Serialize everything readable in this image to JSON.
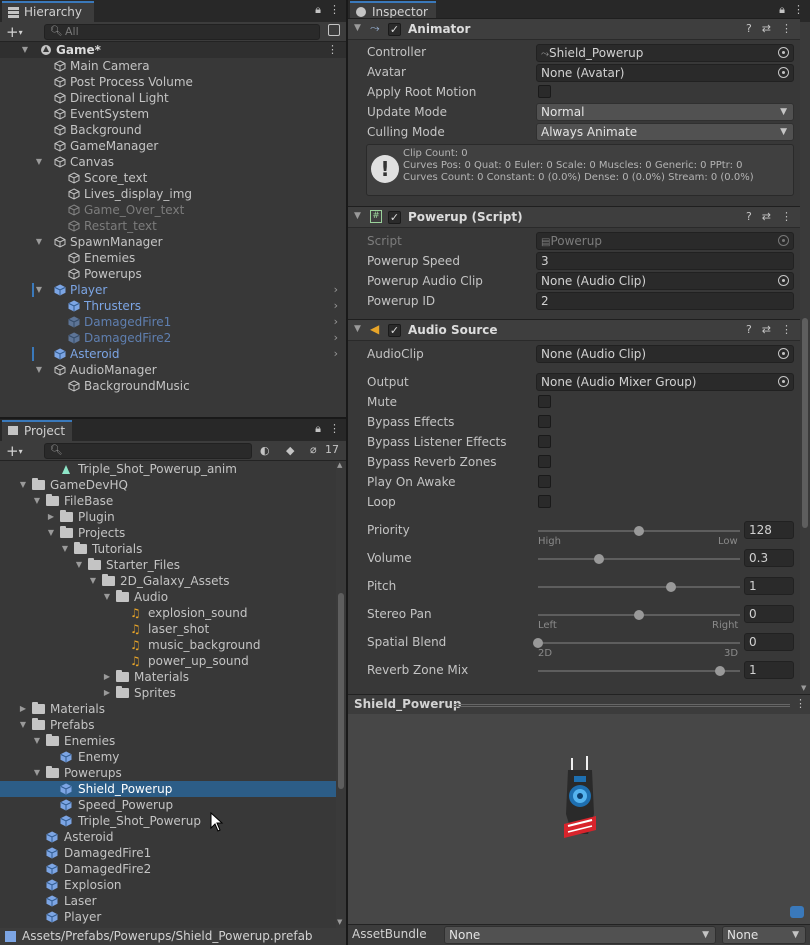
{
  "hierarchy": {
    "tab_label": "Hierarchy",
    "search_placeholder": "All",
    "rows": [
      {
        "label": "Game*",
        "depth": 0,
        "arrow": "down",
        "icon": "unity-scene-icon",
        "style": "bold"
      },
      {
        "label": "Main Camera",
        "depth": 1,
        "arrow": "",
        "icon": "gameobject-icon",
        "style": "normal"
      },
      {
        "label": "Post Process Volume",
        "depth": 1,
        "arrow": "",
        "icon": "gameobject-icon",
        "style": "normal"
      },
      {
        "label": "Directional Light",
        "depth": 1,
        "arrow": "",
        "icon": "gameobject-icon",
        "style": "normal"
      },
      {
        "label": "EventSystem",
        "depth": 1,
        "arrow": "",
        "icon": "gameobject-icon",
        "style": "normal"
      },
      {
        "label": "Background",
        "depth": 1,
        "arrow": "",
        "icon": "gameobject-icon",
        "style": "normal"
      },
      {
        "label": "GameManager",
        "depth": 1,
        "arrow": "",
        "icon": "gameobject-icon",
        "style": "normal"
      },
      {
        "label": "Canvas",
        "depth": 1,
        "arrow": "down",
        "icon": "gameobject-icon",
        "style": "normal"
      },
      {
        "label": "Score_text",
        "depth": 2,
        "arrow": "",
        "icon": "gameobject-icon",
        "style": "normal"
      },
      {
        "label": "Lives_display_img",
        "depth": 2,
        "arrow": "",
        "icon": "gameobject-icon",
        "style": "normal"
      },
      {
        "label": "Game_Over_text",
        "depth": 2,
        "arrow": "",
        "icon": "gameobject-icon",
        "style": "dim"
      },
      {
        "label": "Restart_text",
        "depth": 2,
        "arrow": "",
        "icon": "gameobject-icon",
        "style": "dim"
      },
      {
        "label": "SpawnManager",
        "depth": 1,
        "arrow": "down",
        "icon": "gameobject-icon",
        "style": "normal"
      },
      {
        "label": "Enemies",
        "depth": 2,
        "arrow": "",
        "icon": "gameobject-icon",
        "style": "normal"
      },
      {
        "label": "Powerups",
        "depth": 2,
        "arrow": "",
        "icon": "gameobject-icon",
        "style": "normal"
      },
      {
        "label": "Player",
        "depth": 1,
        "arrow": "down",
        "icon": "prefab-icon",
        "style": "blue",
        "chevron": true,
        "marker": true
      },
      {
        "label": "Thrusters",
        "depth": 2,
        "arrow": "",
        "icon": "prefab-icon",
        "style": "blue",
        "chevron": true
      },
      {
        "label": "DamagedFire1",
        "depth": 2,
        "arrow": "",
        "icon": "prefab-icon",
        "style": "dimblue",
        "chevron": true
      },
      {
        "label": "DamagedFire2",
        "depth": 2,
        "arrow": "",
        "icon": "prefab-icon",
        "style": "dimblue",
        "chevron": true
      },
      {
        "label": "Asteroid",
        "depth": 1,
        "arrow": "",
        "icon": "prefab-icon",
        "style": "blue",
        "chevron": true,
        "marker": true
      },
      {
        "label": "AudioManager",
        "depth": 1,
        "arrow": "down",
        "icon": "gameobject-icon",
        "style": "normal"
      },
      {
        "label": "BackgroundMusic",
        "depth": 2,
        "arrow": "",
        "icon": "gameobject-icon",
        "style": "normal"
      }
    ]
  },
  "project": {
    "tab_label": "Project",
    "hidden_count": "17",
    "rows": [
      {
        "label": "Triple_Shot_Powerup_anim",
        "depth": 2,
        "arrow": "",
        "icon": "anim-icon"
      },
      {
        "label": "GameDevHQ",
        "depth": 0,
        "arrow": "down",
        "icon": "folder-icon"
      },
      {
        "label": "FileBase",
        "depth": 1,
        "arrow": "down",
        "icon": "folder-icon"
      },
      {
        "label": "Plugin",
        "depth": 2,
        "arrow": "right",
        "icon": "folder-icon"
      },
      {
        "label": "Projects",
        "depth": 2,
        "arrow": "down",
        "icon": "folder-icon"
      },
      {
        "label": "Tutorials",
        "depth": 3,
        "arrow": "down",
        "icon": "folder-icon"
      },
      {
        "label": "Starter_Files",
        "depth": 4,
        "arrow": "down",
        "icon": "folder-icon"
      },
      {
        "label": "2D_Galaxy_Assets",
        "depth": 5,
        "arrow": "down",
        "icon": "folder-icon"
      },
      {
        "label": "Audio",
        "depth": 6,
        "arrow": "down",
        "icon": "folder-icon"
      },
      {
        "label": "explosion_sound",
        "depth": 7,
        "arrow": "",
        "icon": "audio-icon"
      },
      {
        "label": "laser_shot",
        "depth": 7,
        "arrow": "",
        "icon": "audio-icon"
      },
      {
        "label": "music_background",
        "depth": 7,
        "arrow": "",
        "icon": "audio-icon"
      },
      {
        "label": "power_up_sound",
        "depth": 7,
        "arrow": "",
        "icon": "audio-icon"
      },
      {
        "label": "Materials",
        "depth": 6,
        "arrow": "right",
        "icon": "folder-icon"
      },
      {
        "label": "Sprites",
        "depth": 6,
        "arrow": "right",
        "icon": "folder-icon"
      },
      {
        "label": "Materials",
        "depth": 0,
        "arrow": "right",
        "icon": "folder-icon"
      },
      {
        "label": "Prefabs",
        "depth": 0,
        "arrow": "down",
        "icon": "folder-icon"
      },
      {
        "label": "Enemies",
        "depth": 1,
        "arrow": "down",
        "icon": "folder-icon"
      },
      {
        "label": "Enemy",
        "depth": 2,
        "arrow": "",
        "icon": "prefab-icon"
      },
      {
        "label": "Powerups",
        "depth": 1,
        "arrow": "down",
        "icon": "folder-icon"
      },
      {
        "label": "Shield_Powerup",
        "depth": 2,
        "arrow": "",
        "icon": "prefab-icon",
        "selected": true
      },
      {
        "label": "Speed_Powerup",
        "depth": 2,
        "arrow": "",
        "icon": "prefab-icon"
      },
      {
        "label": "Triple_Shot_Powerup",
        "depth": 2,
        "arrow": "",
        "icon": "prefab-icon"
      },
      {
        "label": "Asteroid",
        "depth": 1,
        "arrow": "",
        "icon": "prefab-icon"
      },
      {
        "label": "DamagedFire1",
        "depth": 1,
        "arrow": "",
        "icon": "prefab-icon"
      },
      {
        "label": "DamagedFire2",
        "depth": 1,
        "arrow": "",
        "icon": "prefab-icon"
      },
      {
        "label": "Explosion",
        "depth": 1,
        "arrow": "",
        "icon": "prefab-icon"
      },
      {
        "label": "Laser",
        "depth": 1,
        "arrow": "",
        "icon": "prefab-icon"
      },
      {
        "label": "Player",
        "depth": 1,
        "arrow": "",
        "icon": "prefab-icon"
      }
    ],
    "status_path": "Assets/Prefabs/Powerups/Shield_Powerup.prefab"
  },
  "inspector": {
    "tab_label": "Inspector",
    "animator": {
      "title": "Animator",
      "controller_label": "Controller",
      "controller_value": "Shield_Powerup",
      "avatar_label": "Avatar",
      "avatar_value": "None (Avatar)",
      "root_motion_label": "Apply Root Motion",
      "update_mode_label": "Update Mode",
      "update_mode_value": "Normal",
      "culling_mode_label": "Culling Mode",
      "culling_mode_value": "Always Animate",
      "info_line1": "Clip Count: 0",
      "info_line2": "Curves Pos: 0 Quat: 0 Euler: 0 Scale: 0 Muscles: 0 Generic: 0 PPtr: 0",
      "info_line3": "Curves Count: 0 Constant: 0 (0.0%) Dense: 0 (0.0%) Stream: 0 (0.0%)"
    },
    "powerup": {
      "title": "Powerup (Script)",
      "script_label": "Script",
      "script_value": "Powerup",
      "speed_label": "Powerup Speed",
      "speed_value": "3",
      "clip_label": "Powerup Audio Clip",
      "clip_value": "None (Audio Clip)",
      "id_label": "Powerup ID",
      "id_value": "2"
    },
    "audio": {
      "title": "Audio Source",
      "audioclip_label": "AudioClip",
      "audioclip_value": "None (Audio Clip)",
      "output_label": "Output",
      "output_value": "None (Audio Mixer Group)",
      "mute_label": "Mute",
      "bypass_effects_label": "Bypass Effects",
      "bypass_listener_label": "Bypass Listener Effects",
      "bypass_reverb_label": "Bypass Reverb Zones",
      "play_on_awake_label": "Play On Awake",
      "loop_label": "Loop",
      "priority_label": "Priority",
      "priority_value": "128",
      "priority_min": "High",
      "priority_max": "Low",
      "volume_label": "Volume",
      "volume_value": "0.3",
      "pitch_label": "Pitch",
      "pitch_value": "1",
      "stereo_label": "Stereo Pan",
      "stereo_value": "0",
      "stereo_min": "Left",
      "stereo_max": "Right",
      "spatial_label": "Spatial Blend",
      "spatial_value": "0",
      "spatial_min": "2D",
      "spatial_max": "3D",
      "reverb_label": "Reverb Zone Mix",
      "reverb_value": "1"
    },
    "sliders": {
      "priority_fraction": 0.5,
      "volume_fraction": 0.3,
      "pitch_fraction": 0.66,
      "stereo_fraction": 0.5,
      "spatial_fraction": 0.0,
      "reverb_fraction": 0.9
    },
    "preview_title": "Shield_Powerup",
    "assetbundle_label": "AssetBundle",
    "assetbundle_value": "None",
    "variant_value": "None"
  },
  "colors": {
    "accent": "#3a79bb",
    "selection": "#2c5d87",
    "prefab_blue": "#7ca5e4",
    "panel_bg": "#383838"
  }
}
